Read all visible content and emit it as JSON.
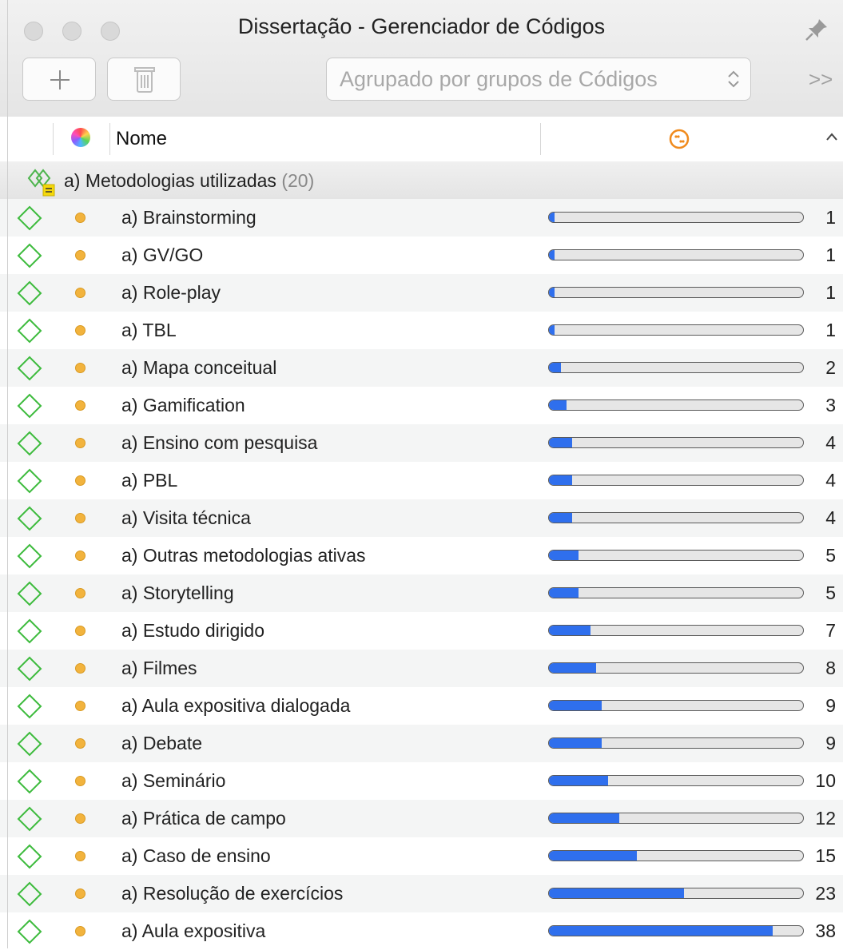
{
  "window": {
    "title": "Dissertação - Gerenciador de Códigos"
  },
  "toolbar": {
    "add_label": "+",
    "grouping_select": "Agrupado por grupos de Códigos",
    "overflow_label": ">>"
  },
  "columns": {
    "name_header": "Nome",
    "frequency_icon": "frequency-icon",
    "sort_icon": "chevron-up-icon"
  },
  "colors": {
    "bar_fill": "#2f6fed",
    "code_dot": "#f2b33d",
    "code_icon": "#3dbb3d"
  },
  "group": {
    "label": "a) Metodologias utilizadas",
    "count_text": "(20)"
  },
  "max_count": 38,
  "codes": [
    {
      "name": "a) Brainstorming",
      "count": "1"
    },
    {
      "name": "a) GV/GO",
      "count": "1"
    },
    {
      "name": "a) Role-play",
      "count": "1"
    },
    {
      "name": "a) TBL",
      "count": "1"
    },
    {
      "name": "a) Mapa conceitual",
      "count": "2"
    },
    {
      "name": "a) Gamification",
      "count": "3"
    },
    {
      "name": "a) Ensino com pesquisa",
      "count": "4"
    },
    {
      "name": "a) PBL",
      "count": "4"
    },
    {
      "name": "a) Visita técnica",
      "count": "4"
    },
    {
      "name": "a) Outras metodologias ativas",
      "count": "5"
    },
    {
      "name": "a) Storytelling",
      "count": "5"
    },
    {
      "name": "a) Estudo dirigido",
      "count": "7"
    },
    {
      "name": "a) Filmes",
      "count": "8"
    },
    {
      "name": "a) Aula expositiva dialogada",
      "count": "9"
    },
    {
      "name": "a) Debate",
      "count": "9"
    },
    {
      "name": "a) Seminário",
      "count": "10"
    },
    {
      "name": "a) Prática de campo",
      "count": "12"
    },
    {
      "name": "a) Caso de ensino",
      "count": "15"
    },
    {
      "name": "a) Resolução de exercícios",
      "count": "23"
    },
    {
      "name": "a) Aula expositiva",
      "count": "38"
    }
  ]
}
